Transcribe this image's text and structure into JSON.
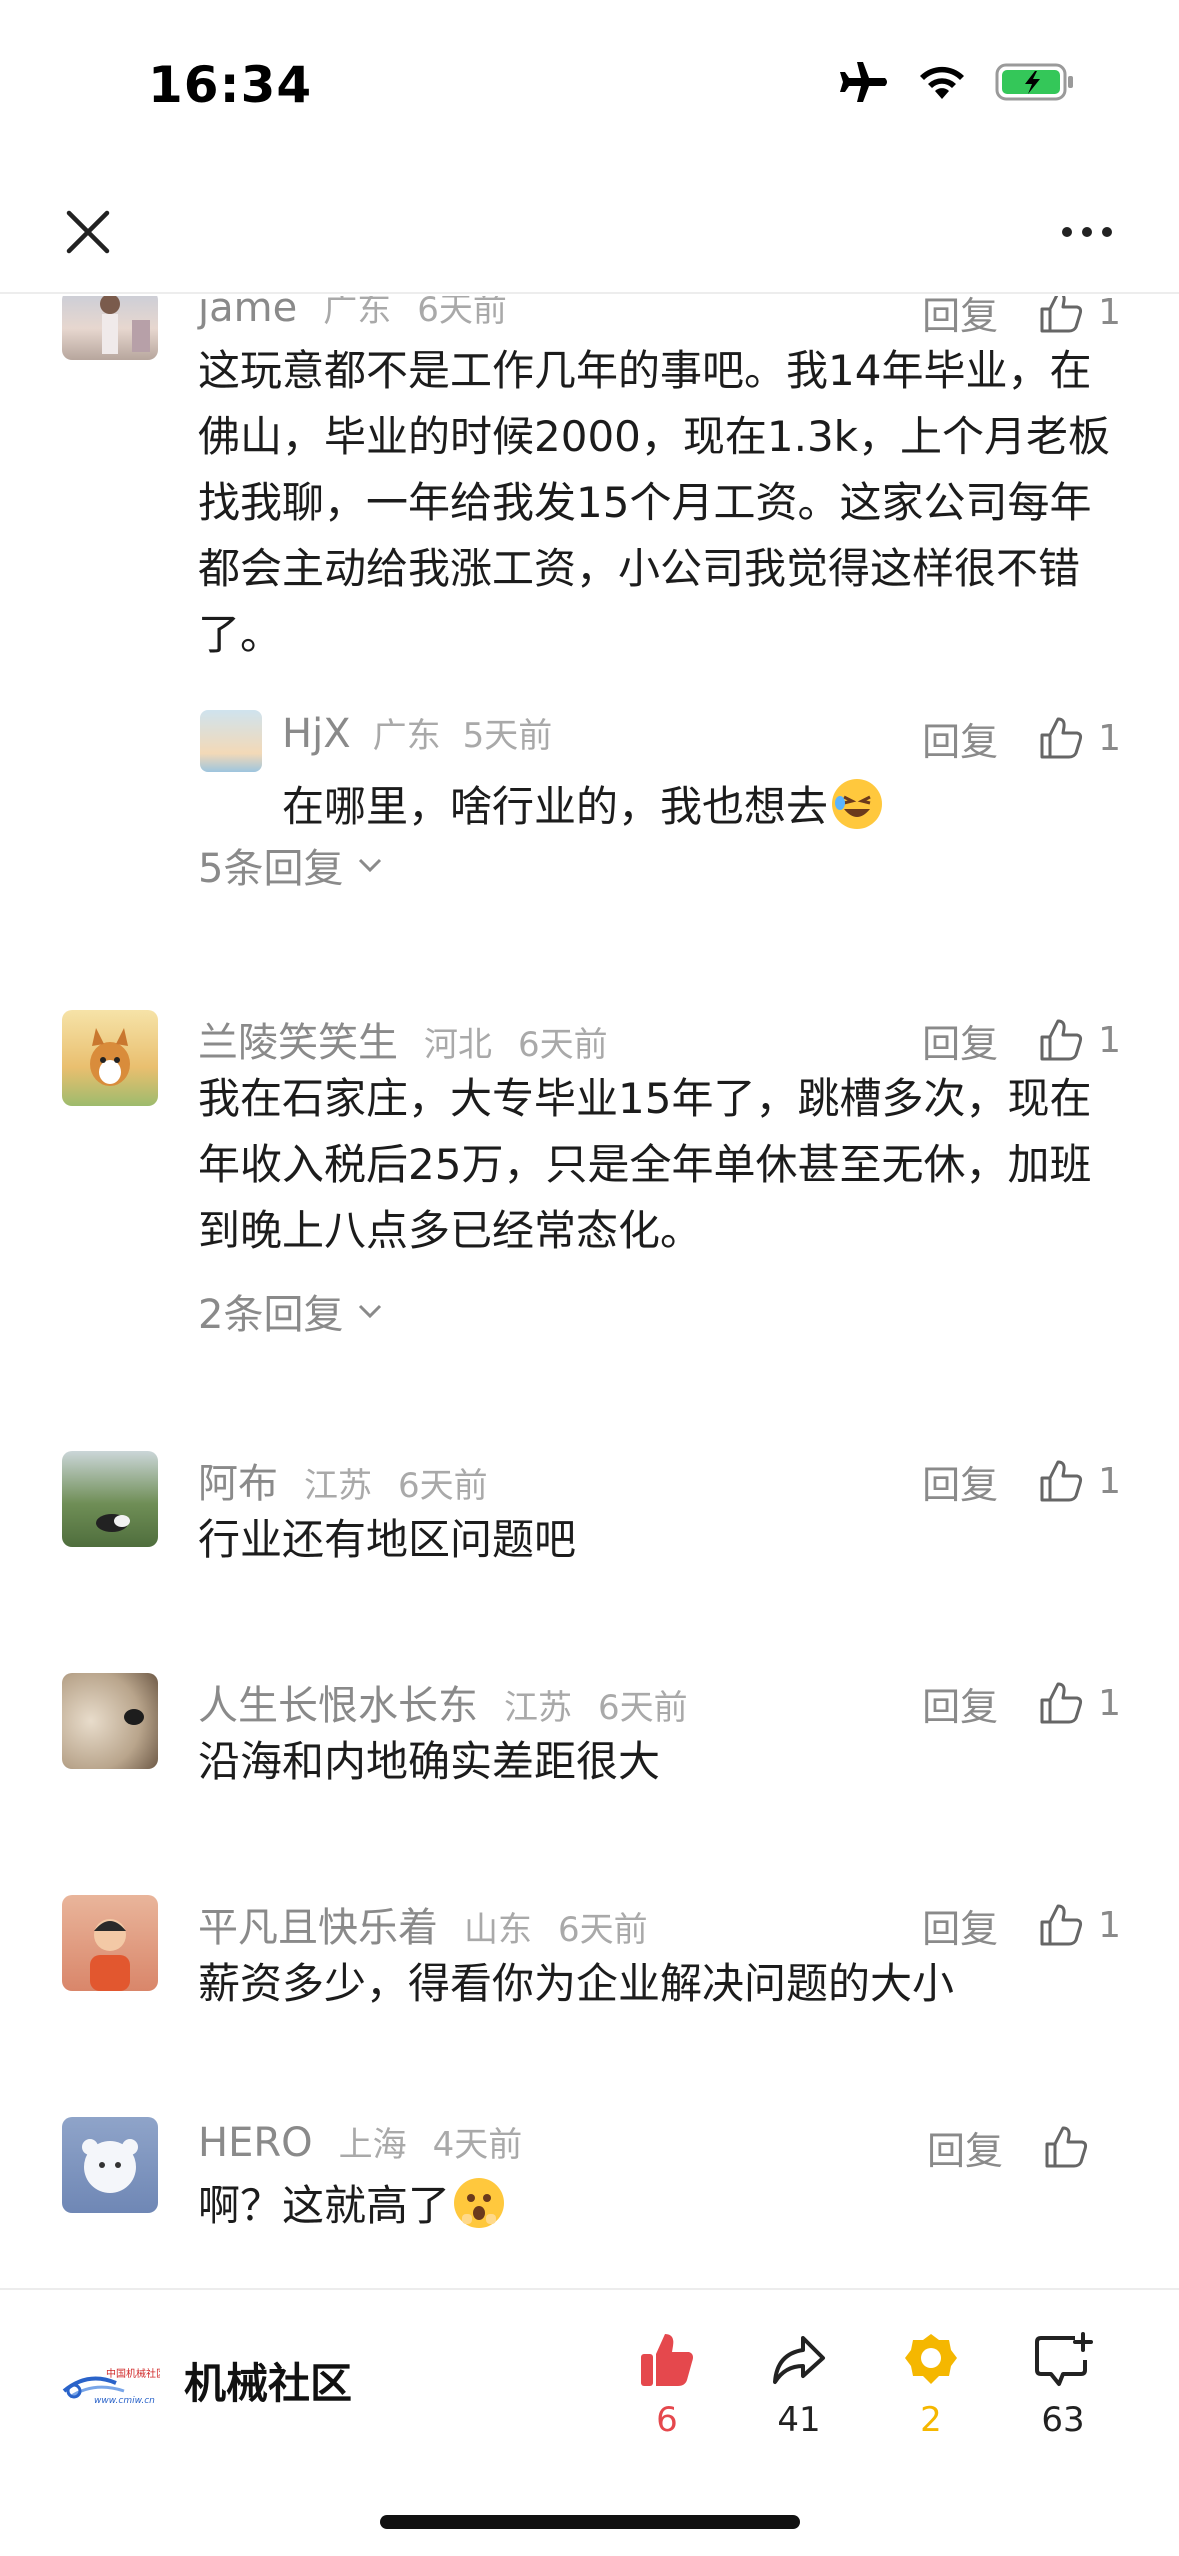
{
  "status": {
    "time": "16:34"
  },
  "comments": [
    {
      "name": "jame",
      "location": "广东",
      "time": "6天前",
      "reply_label": "回复",
      "likes": "1",
      "text": "这玩意都不是工作几年的事吧。我14年毕业，在佛山，毕业的时候2000，现在1.3k，上个月老板找我聊，一年给我发15个月工资。这家公司每年都会主动给我涨工资，小公司我觉得这样很不错了。",
      "sub_reply": {
        "name": "HjX",
        "location": "广东",
        "time": "5天前",
        "reply_label": "回复",
        "likes": "1",
        "text": "在哪里，啥行业的，我也想去"
      },
      "more_replies": "5条回复"
    },
    {
      "name": "兰陵笑笑生",
      "location": "河北",
      "time": "6天前",
      "reply_label": "回复",
      "likes": "1",
      "text": "我在石家庄，大专毕业15年了，跳槽多次，现在年收入税后25万，只是全年单休甚至无休，加班到晚上八点多已经常态化。",
      "more_replies": "2条回复"
    },
    {
      "name": "阿布",
      "location": "江苏",
      "time": "6天前",
      "reply_label": "回复",
      "likes": "1",
      "text": "行业还有地区问题吧"
    },
    {
      "name": "人生长恨水长东",
      "location": "江苏",
      "time": "6天前",
      "reply_label": "回复",
      "likes": "1",
      "text": "沿海和内地确实差距很大"
    },
    {
      "name": "平凡且快乐着",
      "location": "山东",
      "time": "6天前",
      "reply_label": "回复",
      "likes": "1",
      "text": "薪资多少，得看你为企业解决问题的大小"
    },
    {
      "name": "HERO",
      "location": "上海",
      "time": "4天前",
      "reply_label": "回复",
      "likes": "",
      "text": "啊？这就高了"
    }
  ],
  "bottom_bar": {
    "brand_name": "机械社区",
    "brand_logo_text": "中国机械社区",
    "brand_logo_url_text": "www.cmiw.cn",
    "like_count": "6",
    "share_count": "41",
    "collect_count": "2",
    "comment_count": "63"
  },
  "colors": {
    "accent_red": "#e5484d",
    "gold": "#f5b700",
    "muted_text": "#8a8a8a"
  },
  "icons": [
    "airplane-icon",
    "wifi-icon",
    "battery-charging-icon",
    "close-icon",
    "more-icon",
    "thumb-up-icon",
    "chevron-down-icon",
    "share-icon",
    "collect-icon",
    "comment-add-icon",
    "laughing-emoji",
    "shocked-emoji"
  ]
}
